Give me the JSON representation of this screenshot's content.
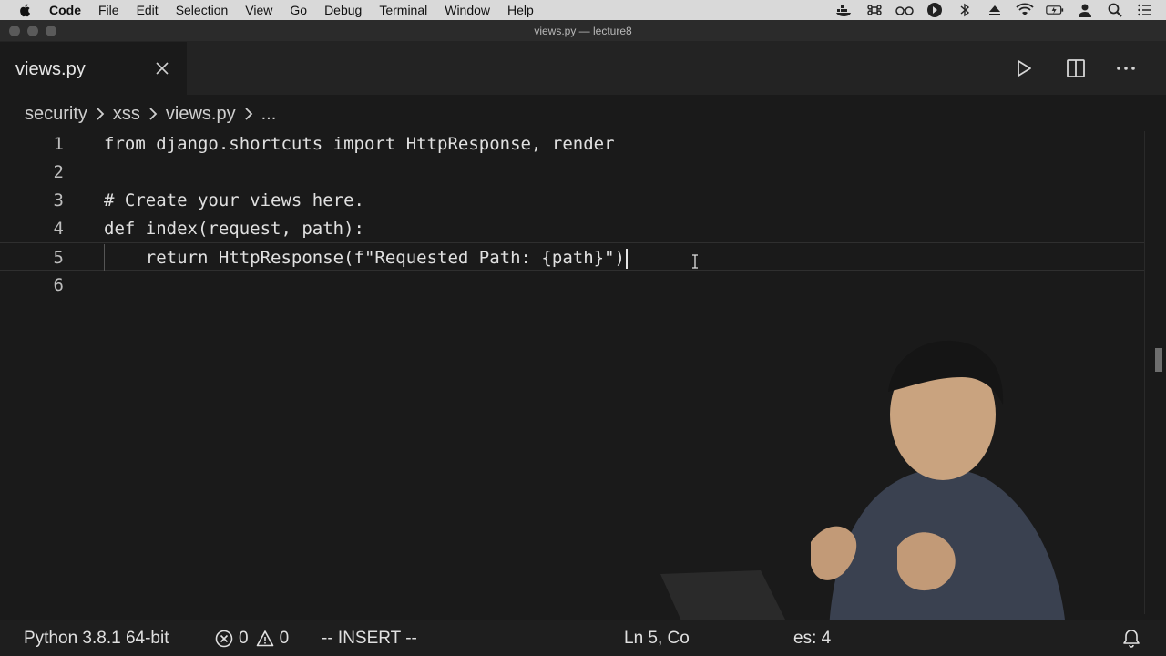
{
  "menubar": {
    "items": [
      "Code",
      "File",
      "Edit",
      "Selection",
      "View",
      "Go",
      "Debug",
      "Terminal",
      "Window",
      "Help"
    ]
  },
  "window": {
    "title": "views.py — lecture8"
  },
  "tab": {
    "label": "views.py"
  },
  "breadcrumb": [
    "security",
    "xss",
    "views.py",
    "..."
  ],
  "editor": {
    "lines": [
      {
        "num": "1",
        "text": "from django.shortcuts import HttpResponse, render"
      },
      {
        "num": "2",
        "text": ""
      },
      {
        "num": "3",
        "text": "# Create your views here."
      },
      {
        "num": "4",
        "text": "def index(request, path):"
      },
      {
        "num": "5",
        "text": "    return HttpResponse(f\"Requested Path: {path}\")"
      },
      {
        "num": "6",
        "text": ""
      }
    ],
    "current_line": "5"
  },
  "statusbar": {
    "interpreter": "Python 3.8.1 64-bit",
    "errors": "0",
    "warnings": "0",
    "mode": "-- INSERT --",
    "position": "Ln 5, Co",
    "spaces": "es: 4"
  },
  "colors": {
    "menubar": "#d9d9d9",
    "editor_bg": "#1a1a1a",
    "statusbar_bg": "#1e1e1e"
  }
}
